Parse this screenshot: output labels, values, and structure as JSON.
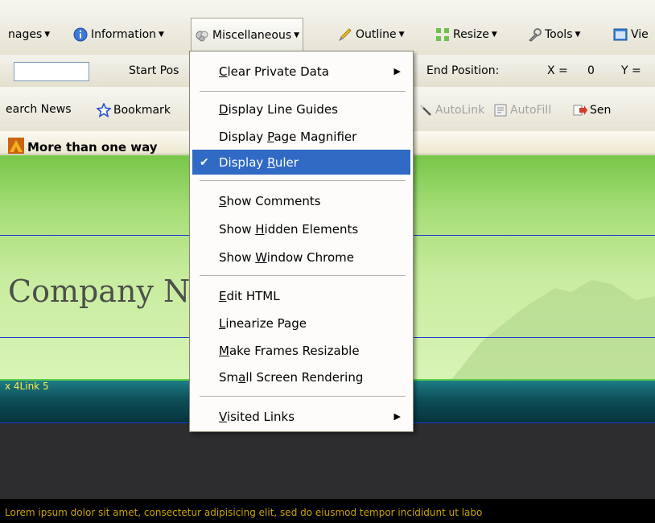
{
  "toolbar": {
    "items": [
      {
        "label": "nages",
        "icon": "images-icon"
      },
      {
        "label": "Information",
        "icon": "info-icon"
      },
      {
        "label": "Miscellaneous",
        "icon": "misc-icon"
      },
      {
        "label": "Outline",
        "icon": "pencil-icon"
      },
      {
        "label": "Resize",
        "icon": "resize-icon"
      },
      {
        "label": "Tools",
        "icon": "wrench-icon"
      },
      {
        "label": "Vie",
        "icon": "view-icon"
      }
    ],
    "dropdown_arrow": "▼"
  },
  "position_bar": {
    "input_value": "",
    "start_label": "Start Pos",
    "end_label": "End Position:",
    "x_label": "X =",
    "x_value": "0",
    "y_label": "Y ="
  },
  "toolbar3": {
    "search_news": "earch News",
    "bookmarks": "Bookmark",
    "autolink": "AutoLink",
    "autofill": "AutoFill",
    "send": "Sen"
  },
  "infobar": {
    "text": "More than one way"
  },
  "page": {
    "company": "Company N",
    "nav_text": "x 4Link 5",
    "lorem": "Lorem ipsum dolor sit amet, consectetur adipisicing elit, sed do eiusmod tempor incididunt ut labo"
  },
  "menu": {
    "items": [
      {
        "label": "Clear Private Data",
        "accel": "C",
        "rest": "lear Private Data",
        "submenu": true
      },
      {
        "label": "Display Line Guides",
        "pre": "",
        "accel": "D",
        "rest": "isplay Line Guides"
      },
      {
        "label": "Display Page Magnifier",
        "pre": "Display ",
        "accel": "P",
        "rest": "age Magnifier"
      },
      {
        "label": "Display Ruler",
        "pre": "Display ",
        "accel": "R",
        "rest": "uler",
        "checked": true,
        "selected": true
      },
      {
        "label": "Show Comments",
        "pre": "",
        "accel": "S",
        "rest": "how Comments"
      },
      {
        "label": "Show Hidden Elements",
        "pre": "Show ",
        "accel": "H",
        "rest": "idden Elements"
      },
      {
        "label": "Show Window Chrome",
        "pre": "Show ",
        "accel": "W",
        "rest": "indow Chrome"
      },
      {
        "label": "Edit HTML",
        "pre": "",
        "accel": "E",
        "rest": "dit HTML"
      },
      {
        "label": "Linearize Page",
        "pre": "",
        "accel": "L",
        "rest": "inearize Page"
      },
      {
        "label": "Make Frames Resizable",
        "pre": "",
        "accel": "M",
        "rest": "ake Frames Resizable"
      },
      {
        "label": "Small Screen Rendering",
        "pre": "Sm",
        "accel": "a",
        "rest": "ll Screen Rendering"
      },
      {
        "label": "Visited Links",
        "pre": "",
        "accel": "V",
        "rest": "isited Links",
        "submenu": true
      }
    ],
    "check_glyph": "✔",
    "submenu_glyph": "▶"
  },
  "colors": {
    "menu_highlight": "#316ac5",
    "banner_green": "#a7de78",
    "nav_teal": "#0d4f58",
    "lorem_yellow": "#c8a400"
  }
}
